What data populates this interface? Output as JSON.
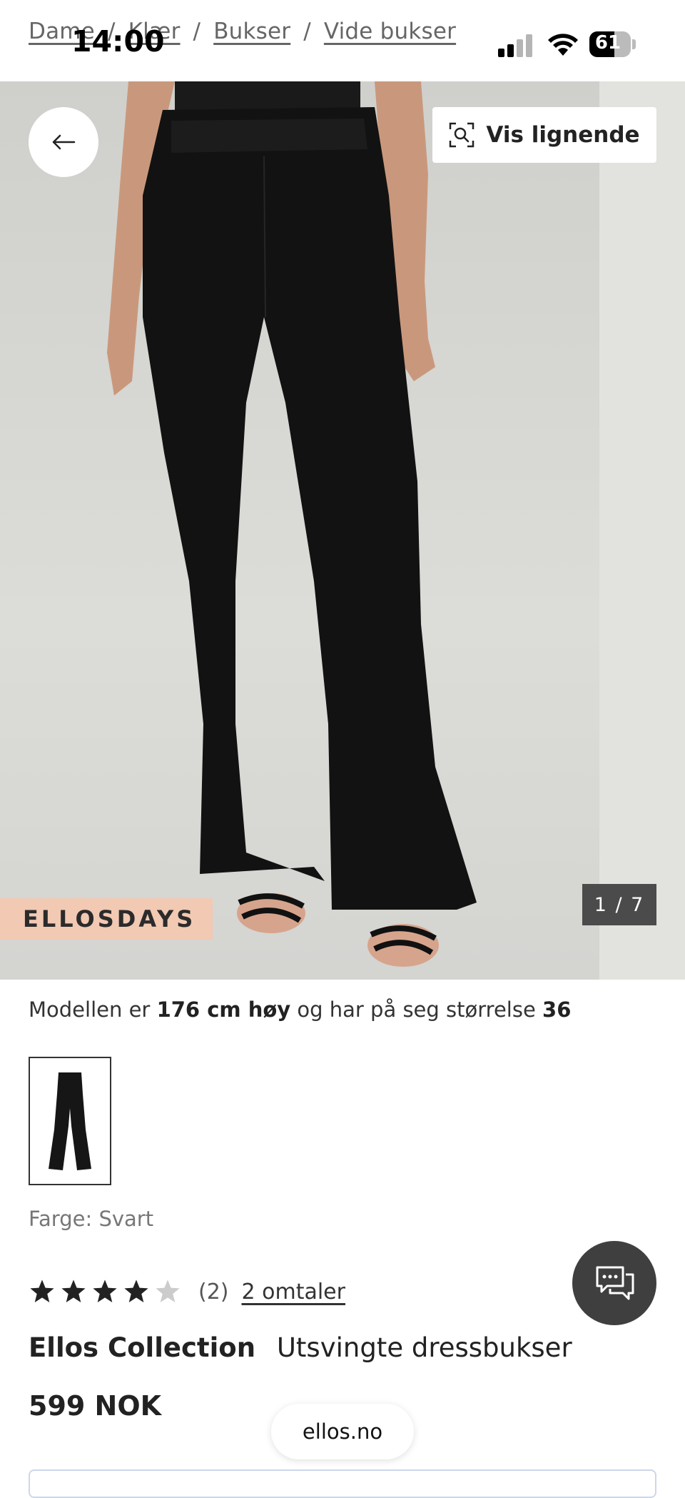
{
  "status_bar": {
    "time": "14:00",
    "battery": "61",
    "battery_level": 0.61
  },
  "breadcrumb": [
    "Dame",
    "Klær",
    "Bukser",
    "Vide bukser"
  ],
  "breadcrumb_separator": "/",
  "hero": {
    "similar_label": "Vis lignende",
    "campaign_tag": "ELLOSDAYS",
    "image_counter": "1 / 7"
  },
  "model_info": {
    "prefix": "Modellen er",
    "height": "176 cm høy",
    "middle": "og har på seg størrelse",
    "size": "36"
  },
  "color": {
    "label": "Farge:",
    "value": "Svart"
  },
  "rating": {
    "value": 4,
    "max": 5,
    "count": "(2)",
    "reviews_link": "2 omtaler"
  },
  "product": {
    "brand": "Ellos Collection",
    "name": "Utsvingte dressbukser",
    "price": "599 NOK"
  },
  "browser": {
    "domain": "ellos.no"
  },
  "icons": {
    "back": "arrow-left-icon",
    "similar": "visual-search-icon",
    "chat": "chat-bubbles-icon",
    "star": "star-icon"
  },
  "colors": {
    "tag_bg": "#f2c9b3",
    "counter_bg": "#4b4b4b",
    "chat_bg": "#3f3f3f",
    "star_filled": "#222222",
    "star_empty": "#cccccc"
  }
}
